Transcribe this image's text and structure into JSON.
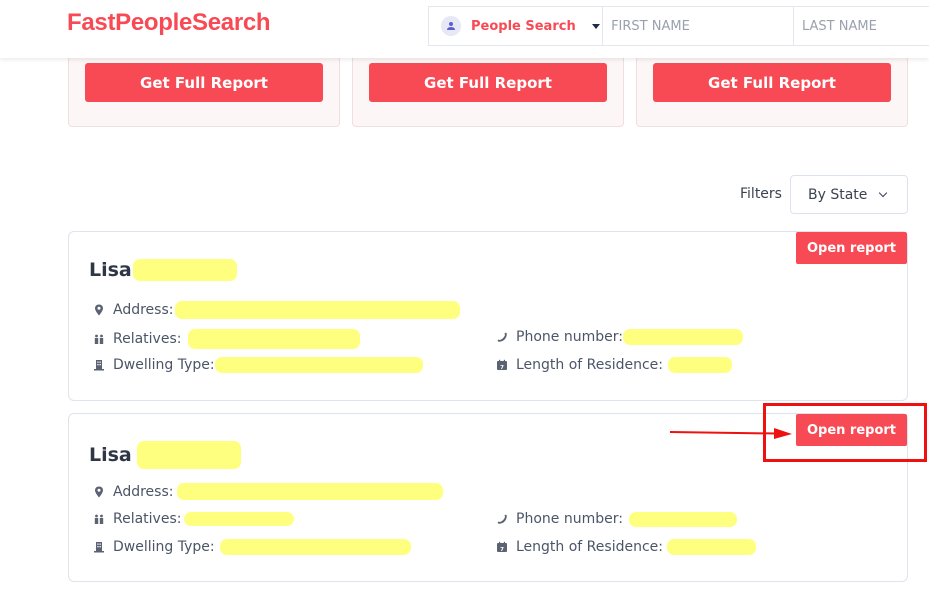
{
  "header": {
    "logo": "FastPeopleSearch",
    "search_type": {
      "label": "People Search",
      "icon": "person-icon"
    },
    "first_name": {
      "placeholder": "FIRST NAME",
      "value": ""
    },
    "last_name": {
      "placeholder": "LAST NAME",
      "value": ""
    }
  },
  "promo_cards": [
    {
      "button_label": "Get Full Report"
    },
    {
      "button_label": "Get Full Report"
    },
    {
      "button_label": "Get Full Report"
    }
  ],
  "filters": {
    "label": "Filters",
    "selected": "By State"
  },
  "results": [
    {
      "first_name": "Lisa",
      "open_label": "Open report",
      "fields": {
        "address": "Address:",
        "relatives": "Relatives:",
        "dwelling": "Dwelling Type:",
        "phone": "Phone number:",
        "residence": "Length of Residence:"
      }
    },
    {
      "first_name": "Lisa",
      "open_label": "Open report",
      "fields": {
        "address": "Address:",
        "relatives": "Relatives:",
        "dwelling": "Dwelling Type:",
        "phone": "Phone number:",
        "residence": "Length of Residence:"
      }
    }
  ],
  "colors": {
    "brand": "#f84a55",
    "redaction": "#ffff7f",
    "annotation": "#ee1111"
  }
}
